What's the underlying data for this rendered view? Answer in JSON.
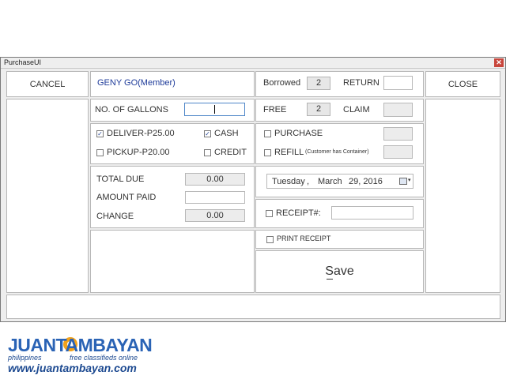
{
  "window": {
    "title": "PurchaseUI",
    "close_symbol": "✕"
  },
  "buttons": {
    "cancel": "CANCEL",
    "close": "CLOSE",
    "save": "Save"
  },
  "customer": {
    "name": "GENY GO(Member)"
  },
  "gallons": {
    "label": "NO. OF GALLONS",
    "value": ""
  },
  "delivery": {
    "deliver_label": "DELIVER-P25.00",
    "deliver_checked": true,
    "pickup_label": "PICKUP-P20.00",
    "pickup_checked": false
  },
  "payment": {
    "cash_label": "CASH",
    "cash_checked": true,
    "credit_label": "CREDIT",
    "credit_checked": false
  },
  "totals": {
    "total_due_label": "TOTAL DUE",
    "total_due": "0.00",
    "amount_paid_label": "AMOUNT PAID",
    "amount_paid": "",
    "change_label": "CHANGE",
    "change": "0.00"
  },
  "containers": {
    "borrowed_label": "Borrowed",
    "borrowed": "2",
    "return_label": "RETURN",
    "return_value": "",
    "free_label": "FREE",
    "free": "2",
    "claim_label": "CLAIM",
    "claim_value": ""
  },
  "options": {
    "purchase_label": "PURCHASE",
    "purchase_checked": false,
    "refill_label": "REFILL",
    "refill_note": "(Customer has Container)",
    "refill_checked": false
  },
  "date": {
    "weekday": "Tuesday",
    "sep": ",",
    "month": "March",
    "day_year": "29, 2016",
    "icon": "calendar-icon"
  },
  "receipt": {
    "receipt_label": "RECEIPT#:",
    "receipt_value": "",
    "print_label": "PRINT RECEIPT"
  },
  "watermark": {
    "brand": "JUANTAMBAYAN",
    "country": "philippines",
    "tagline": "free classifieds online",
    "url": "www.juantambayan.com",
    "colors": {
      "blue": "#2a63b5",
      "orange": "#f2a21b",
      "text": "#1d4a91"
    }
  }
}
